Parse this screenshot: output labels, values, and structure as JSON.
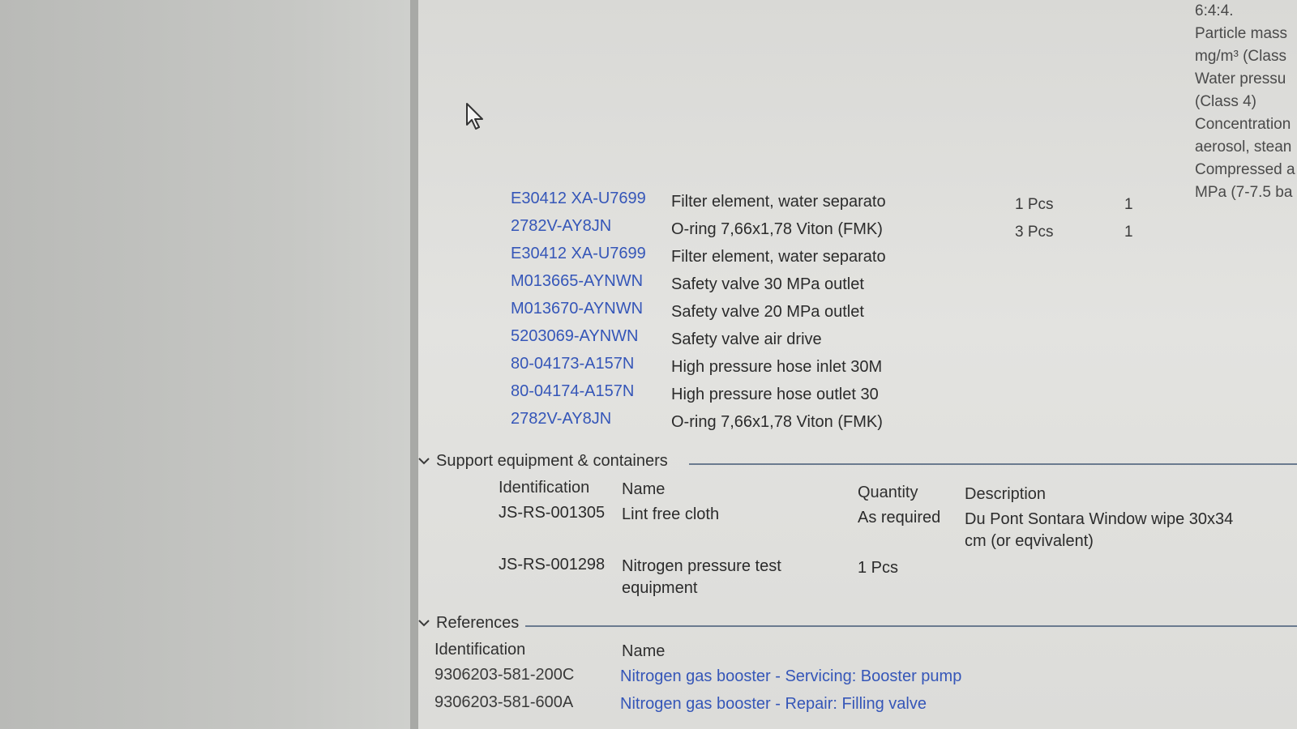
{
  "spec_notes": [
    "6:4:4.",
    "Particle mass",
    "mg/m³ (Class",
    "Water pressu",
    "(Class 4)",
    "Concentration",
    "aerosol, stean",
    "Compressed a",
    "MPa (7-7.5 ba"
  ],
  "parts": [
    {
      "id": "E30412 XA-U7699",
      "name": "Filter element, water separato",
      "qty": "1 Pcs",
      "count": "1"
    },
    {
      "id": "2782V-AY8JN",
      "name": "O-ring 7,66x1,78 Viton (FMK)",
      "qty": "3 Pcs",
      "count": "1"
    },
    {
      "id": "E30412 XA-U7699",
      "name": "Filter element, water separato",
      "qty": "",
      "count": ""
    },
    {
      "id": "M013665-AYNWN",
      "name": "Safety valve 30 MPa outlet",
      "qty": "",
      "count": ""
    },
    {
      "id": "M013670-AYNWN",
      "name": "Safety valve 20 MPa outlet",
      "qty": "",
      "count": ""
    },
    {
      "id": "5203069-AYNWN",
      "name": "Safety valve air drive",
      "qty": "",
      "count": ""
    },
    {
      "id": "80-04173-A157N",
      "name": "High pressure hose inlet 30M",
      "qty": "",
      "count": ""
    },
    {
      "id": "80-04174-A157N",
      "name": "High pressure hose outlet 30",
      "qty": "",
      "count": ""
    },
    {
      "id": "2782V-AY8JN",
      "name": "O-ring 7,66x1,78 Viton (FMK)",
      "qty": "",
      "count": ""
    }
  ],
  "support": {
    "title": "Support equipment & containers",
    "headers": {
      "identification": "Identification",
      "name": "Name",
      "quantity": "Quantity",
      "description": "Description"
    },
    "rows": [
      {
        "id": "JS-RS-001305",
        "name": "Lint free cloth",
        "quantity": "As required",
        "description": "Du Pont Sontara Window wipe 30x34 cm (or eqvivalent)"
      },
      {
        "id": "JS-RS-001298",
        "name": "Nitrogen pressure test equipment",
        "quantity": "1 Pcs",
        "description": ""
      }
    ]
  },
  "references": {
    "title": "References",
    "headers": {
      "identification": "Identification",
      "name": "Name"
    },
    "rows": [
      {
        "id": "9306203-581-200C",
        "name": "Nitrogen gas booster - Servicing: Booster pump"
      },
      {
        "id": "9306203-581-600A",
        "name": "Nitrogen gas booster - Repair: Filling valve"
      }
    ]
  },
  "icons": {
    "cursor": "mouse-pointer-icon",
    "chevron": "chevron-down-icon"
  },
  "colors": {
    "link": "#3556b8",
    "rule": "#6a7a8f"
  }
}
